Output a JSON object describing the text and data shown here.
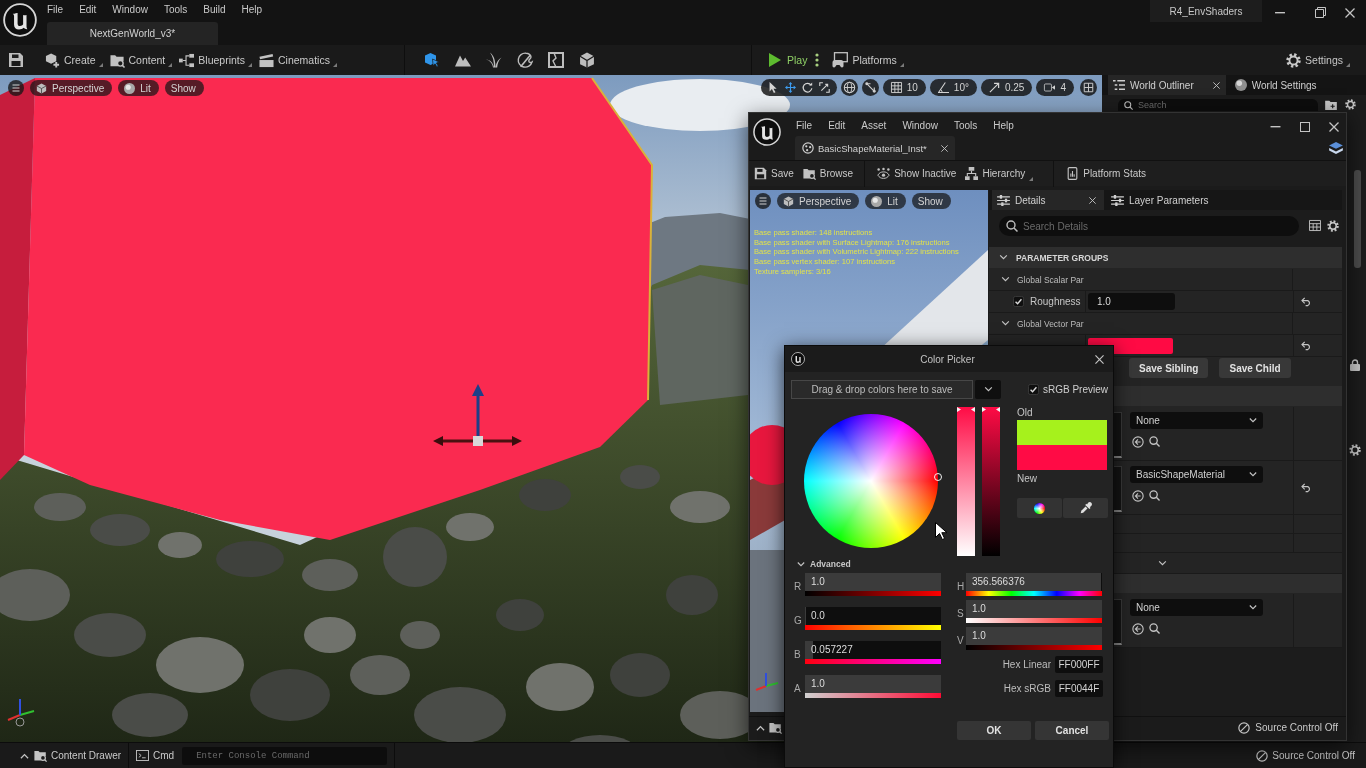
{
  "editor": {
    "menu": [
      "File",
      "Edit",
      "Window",
      "Tools",
      "Build",
      "Help"
    ],
    "document_tab": "NextGenWorld_v3*",
    "project_name": "R4_EnvShaders",
    "toolbar": [
      {
        "kind": "create",
        "label": "Create"
      },
      {
        "kind": "content",
        "label": "Content"
      },
      {
        "kind": "blueprints",
        "label": "Blueprints"
      },
      {
        "kind": "cinematics",
        "label": "Cinematics"
      }
    ],
    "modes": [
      {
        "kind": "select",
        "selected": true
      },
      {
        "kind": "landscape",
        "selected": false
      },
      {
        "kind": "foliage",
        "selected": false
      },
      {
        "kind": "paint",
        "selected": false
      },
      {
        "kind": "fracture",
        "selected": false
      },
      {
        "kind": "modeling",
        "selected": false
      }
    ],
    "play": "Play",
    "platforms": "Platforms",
    "settings": "Settings",
    "viewport": {
      "view_buttons": [
        {
          "kind": "perspective",
          "label": "Perspective"
        },
        {
          "kind": "lit",
          "label": "Lit"
        },
        {
          "kind": "show",
          "label": "Show"
        }
      ],
      "transform_tools": [
        {
          "kind": "select",
          "selected": false
        },
        {
          "kind": "move",
          "selected": true
        },
        {
          "kind": "rotate",
          "selected": false
        },
        {
          "kind": "scale",
          "selected": false
        }
      ],
      "snap_controls": [
        {
          "kind": "grid",
          "value": "10"
        },
        {
          "kind": "angle",
          "value": "10°"
        },
        {
          "kind": "scale",
          "value": "0.25"
        },
        {
          "kind": "camera",
          "value": "4"
        }
      ]
    },
    "outliner": {
      "tabs": [
        {
          "kind": "outliner",
          "label": "World Outliner",
          "selected": true,
          "closable": true
        },
        {
          "kind": "world",
          "label": "World Settings",
          "selected": false,
          "closable": false
        }
      ],
      "search": {
        "placeholder": "Search"
      }
    },
    "status_bar": {
      "content_drawer": "Content Drawer",
      "cmd": "Cmd",
      "console": {
        "placeholder": "Enter Console Command"
      },
      "source_control": "Source Control Off"
    }
  },
  "material_editor": {
    "menu": [
      "File",
      "Edit",
      "Asset",
      "Window",
      "Tools",
      "Help"
    ],
    "document_tab": "BasicShapeMaterial_Inst*",
    "toolbar": [
      {
        "kind": "save",
        "label": "Save"
      },
      {
        "kind": "browse",
        "label": "Browse"
      },
      {
        "kind": "show_inactive",
        "label": "Show Inactive"
      },
      {
        "kind": "hierarchy",
        "label": "Hierarchy"
      },
      {
        "kind": "platform_stats",
        "label": "Platform Stats"
      }
    ],
    "viewport": {
      "view_buttons": [
        {
          "kind": "perspective",
          "label": "Perspective"
        },
        {
          "kind": "lit",
          "label": "Lit"
        },
        {
          "kind": "show",
          "label": "Show"
        }
      ],
      "stats": [
        "Base pass shader: 148 instructions",
        "Base pass shader with Surface Lightmap: 176 instructions",
        "Base pass shader with Volumetric Lightmap: 222 instructions",
        "Base pass vertex shader: 107 instructions",
        "Texture samplers: 3/16"
      ]
    },
    "details": {
      "tabs": [
        {
          "label": "Details",
          "selected": true
        },
        {
          "label": "Layer Parameters",
          "selected": false
        }
      ],
      "search": {
        "placeholder": "Search Details"
      },
      "section": "PARAMETER GROUPS",
      "groups": [
        {
          "name": "Global Scalar Par",
          "expanded": true,
          "params": [
            {
              "kind": "scalar",
              "name": "Roughness",
              "checked": true,
              "value": "1.0",
              "reset": true
            }
          ]
        },
        {
          "name": "Global Vector Par",
          "expanded": true,
          "params": [
            {
              "kind": "color",
              "color": "#ff0a44",
              "reset": true
            }
          ]
        }
      ],
      "actions": [
        "Save Sibling",
        "Save Child"
      ],
      "asset_sections": [
        {
          "slots": [
            {
              "value": "None",
              "reset": false
            },
            {
              "value": "BasicShapeMaterial",
              "reset": true
            }
          ],
          "advanced_collapsed": true
        },
        {
          "slots": [
            {
              "value": "None",
              "reset": false
            }
          ],
          "advanced_collapsed": false
        }
      ]
    },
    "status_bar": {
      "source_control": "Source Control Off"
    }
  },
  "color_picker": {
    "title": "Color Picker",
    "drop_zone": "Drag & drop colors here to save",
    "srgb_preview": {
      "label": "sRGB Preview",
      "checked": true
    },
    "bars": [
      {
        "kind": "saturation",
        "level": 1
      },
      {
        "kind": "value",
        "level": 1
      }
    ],
    "swatches": [
      {
        "label": "Old",
        "color": "#a6f11c"
      },
      {
        "label": "New",
        "color": "#ff0b45"
      }
    ],
    "advanced": {
      "label": "Advanced",
      "expanded": true
    },
    "rgba": [
      {
        "kind": "red",
        "label": "R",
        "value": "1.0",
        "level": 1
      },
      {
        "kind": "green",
        "label": "G",
        "value": "0.0",
        "level": 0
      },
      {
        "kind": "blue",
        "label": "B",
        "value": "0.057227",
        "level": 0.057
      },
      {
        "kind": "alpha",
        "label": "A",
        "value": "1.0",
        "level": 1
      }
    ],
    "hsv": [
      {
        "kind": "hue",
        "label": "H",
        "value": "356.566376",
        "level": 0.99
      },
      {
        "kind": "saturation",
        "label": "S",
        "value": "1.0",
        "level": 1
      },
      {
        "kind": "value",
        "label": "V",
        "value": "1.0",
        "level": 1
      }
    ],
    "hex": [
      {
        "label": "Hex Linear",
        "value": "FF000FF"
      },
      {
        "label": "Hex sRGB",
        "value": "FF0044F"
      }
    ],
    "buttons": [
      "OK",
      "Cancel"
    ]
  }
}
